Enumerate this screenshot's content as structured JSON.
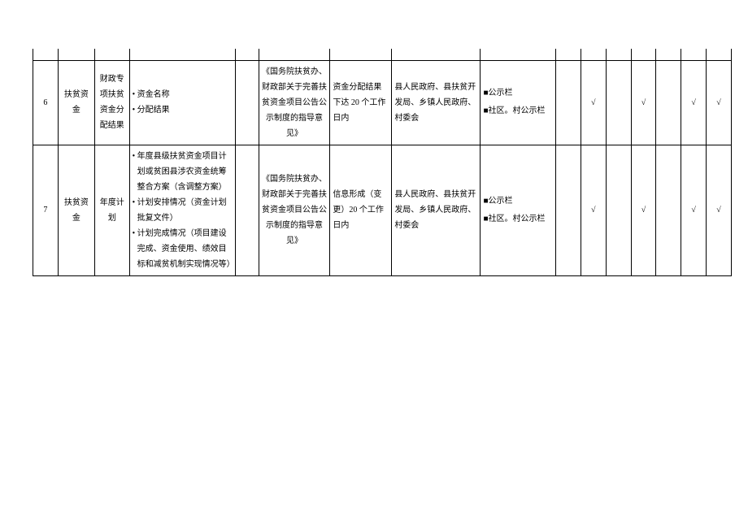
{
  "rows": [
    {
      "index": "6",
      "category": "扶贫资金",
      "subcategory": "财政专项扶贫资金分配结果",
      "content_items": [
        "资金名称",
        "分配结果"
      ],
      "basis": "《国务院扶贫办、财政部关于完善扶贫资金项目公告公示制度的指导意见》",
      "timing": "资金分配结果下达 20 个工作日内",
      "subject": "县人民政府、县扶贫开发局、乡镇人民政府、村委会",
      "channel1": "■公示栏",
      "channel2": "■社区。村公示栏",
      "chk1": "",
      "chk2": "√",
      "chk3": "",
      "chk4": "√",
      "chk5": "",
      "chk6": "√",
      "chk7": "√"
    },
    {
      "index": "7",
      "category": "扶贫资金",
      "subcategory": "年度计划",
      "content_items": [
        "年度县级扶贫资金项目计划或贫困县涉农资金统筹整合方案（含调整方案）",
        "计划安排情况（资金计划批复文件）",
        "计划完成情况（项目建设完成、资金使用、绩效目标和减贫机制实现情况等）"
      ],
      "basis": "《国务院扶贫办、财政部关于完善扶贫资金项目公告公示制度的指导意见》",
      "timing": "信息形成（变更）20 个工作日内",
      "subject": "县人民政府、县扶贫开发局、乡镇人民政府、村委会",
      "channel1": "■公示栏",
      "channel2": "■社区。村公示栏",
      "chk1": "",
      "chk2": "√",
      "chk3": "",
      "chk4": "√",
      "chk5": "",
      "chk6": "√",
      "chk7": "√"
    }
  ]
}
